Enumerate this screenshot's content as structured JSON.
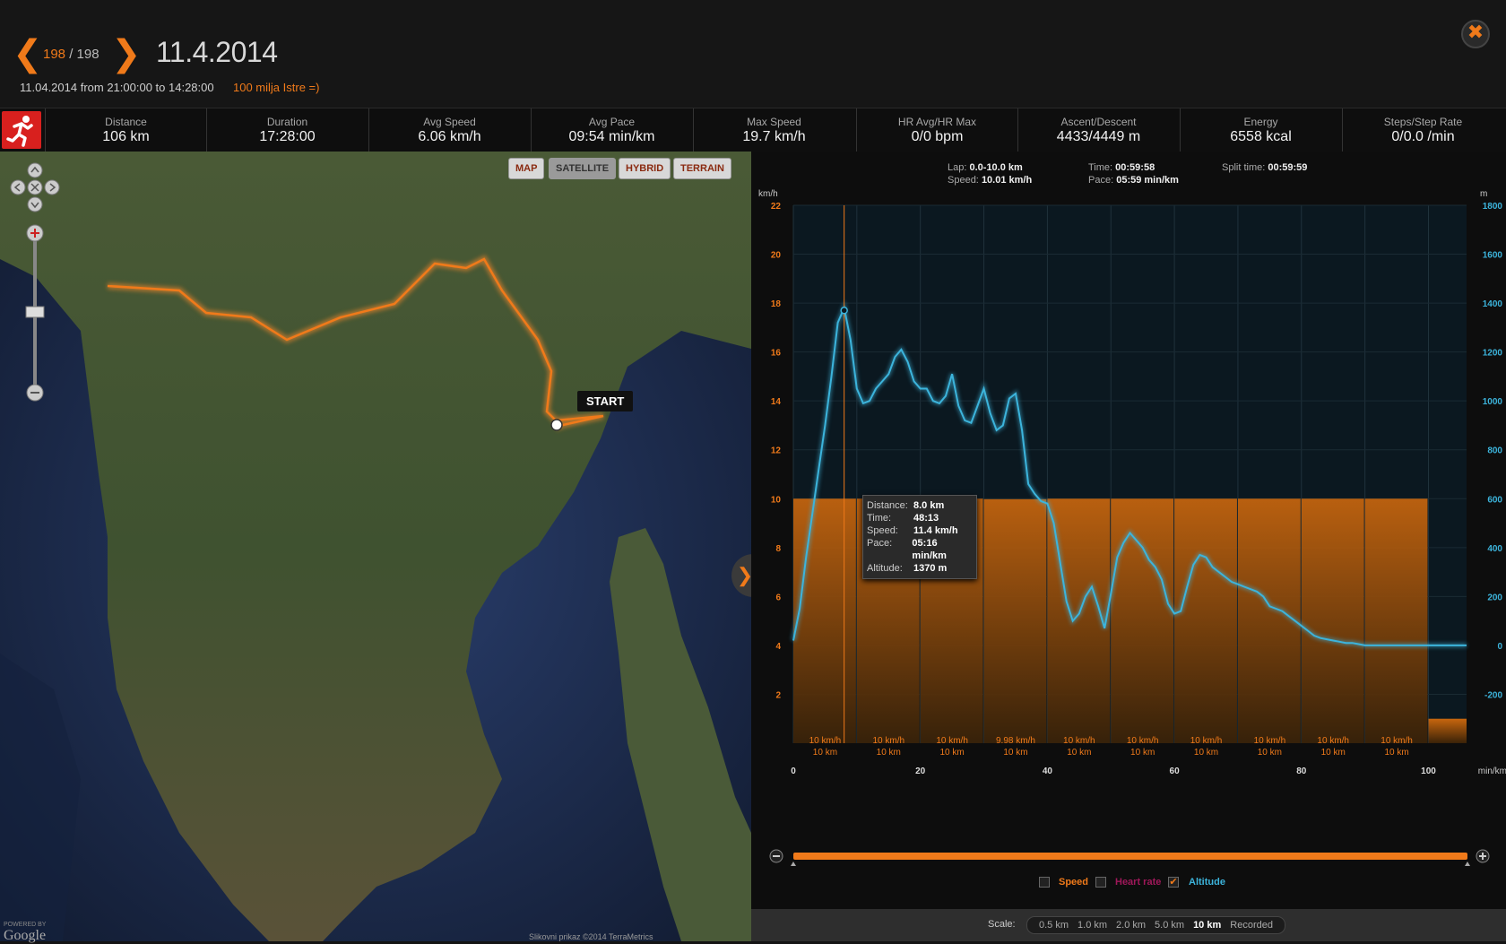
{
  "header": {
    "current_index": "198",
    "separator": "/",
    "total": "198",
    "date": "11.4.2014",
    "time_range": "11.04.2014  from 21:00:00 to 14:28:00",
    "route_name": "100 milja Istre =)"
  },
  "stats": [
    {
      "label": "Distance",
      "value": "106 km"
    },
    {
      "label": "Duration",
      "value": "17:28:00"
    },
    {
      "label": "Avg Speed",
      "value": "6.06 km/h"
    },
    {
      "label": "Avg Pace",
      "value": "09:54 min/km"
    },
    {
      "label": "Max Speed",
      "value": "19.7 km/h"
    },
    {
      "label": "HR Avg/HR Max",
      "value": "0/0 bpm"
    },
    {
      "label": "Ascent/Descent",
      "value": "4433/4449 m"
    },
    {
      "label": "Energy",
      "value": "6558 kcal"
    },
    {
      "label": "Steps/Step Rate",
      "value": "0/0.0 /min"
    }
  ],
  "map": {
    "types": [
      "MAP",
      "SATELLITE",
      "HYBRID",
      "TERRAIN"
    ],
    "active_type": "SATELLITE",
    "start_label": "START",
    "powered_by": "POWERED BY",
    "google": "Google",
    "copyright": "Slikovni prikaz ©2014 TerraMetrics"
  },
  "lap": {
    "lap_label": "Lap:",
    "lap_value": "0.0-10.0 km",
    "speed_label": "Speed:",
    "speed_value": "10.01 km/h",
    "time_label": "Time:",
    "time_value": "00:59:58",
    "pace_label": "Pace:",
    "pace_value": "05:59 min/km",
    "split_label": "Split time:",
    "split_value": "00:59:59"
  },
  "tooltip": {
    "distance_label": "Distance:",
    "distance": "8.0 km",
    "time_label": "Time:",
    "time": "48:13",
    "speed_label": "Speed:",
    "speed": "11.4 km/h",
    "pace_label": "Pace:",
    "pace": "05:16 min/km",
    "altitude_label": "Altitude:",
    "altitude": "1370 m"
  },
  "legend": {
    "speed": "Speed",
    "heart_rate": "Heart rate",
    "altitude": "Altitude",
    "speed_checked": false,
    "heart_rate_checked": false,
    "altitude_checked": true
  },
  "footer": {
    "scale_label": "Scale:",
    "options": [
      "0.5 km",
      "1.0 km",
      "2.0 km",
      "5.0 km",
      "10 km",
      "Recorded"
    ],
    "selected": "10 km"
  },
  "colors": {
    "accent": "#f07a1a",
    "altitude_line": "#3cb4dc",
    "lap_fill": "#c8660e"
  },
  "chart_data": {
    "type": "area",
    "left_axis_label": "km/h",
    "right_axis_label": "m",
    "x_axis_unit": "min/km",
    "left_ticks": [
      "2",
      "4",
      "6",
      "8",
      "10",
      "12",
      "14",
      "16",
      "18",
      "20",
      "22"
    ],
    "right_ticks": [
      "-200",
      "0",
      "200",
      "400",
      "600",
      "800",
      "1000",
      "1200",
      "1400",
      "1600",
      "1800"
    ],
    "x_ticks": [
      "0",
      "20",
      "40",
      "60",
      "80",
      "100"
    ],
    "ylim_left": [
      0,
      22
    ],
    "ylim_right": [
      -400,
      1800
    ],
    "xlim": [
      0,
      106
    ],
    "laps": [
      {
        "speed": "10 km/h",
        "dist": "10 km",
        "value": 10
      },
      {
        "speed": "10 km/h",
        "dist": "10 km",
        "value": 10
      },
      {
        "speed": "10 km/h",
        "dist": "10 km",
        "value": 10
      },
      {
        "speed": "9.98 km/h",
        "dist": "10 km",
        "value": 9.98
      },
      {
        "speed": "10 km/h",
        "dist": "10 km",
        "value": 10
      },
      {
        "speed": "10 km/h",
        "dist": "10 km",
        "value": 10
      },
      {
        "speed": "10 km/h",
        "dist": "10 km",
        "value": 10
      },
      {
        "speed": "10 km/h",
        "dist": "10 km",
        "value": 10
      },
      {
        "speed": "10 km/h",
        "dist": "10 km",
        "value": 10
      },
      {
        "speed": "10 km/h",
        "dist": "10 km",
        "value": 10
      }
    ],
    "last_lap_value": 1.0,
    "altitude": {
      "name": "Altitude",
      "x": [
        0,
        1,
        2,
        3,
        4,
        5,
        6,
        7,
        8,
        9,
        10,
        11,
        12,
        13,
        14,
        15,
        16,
        17,
        18,
        19,
        20,
        21,
        22,
        23,
        24,
        25,
        26,
        27,
        28,
        29,
        30,
        31,
        32,
        33,
        34,
        35,
        36,
        37,
        38,
        39,
        40,
        41,
        42,
        43,
        44,
        45,
        46,
        47,
        48,
        49,
        50,
        51,
        52,
        53,
        54,
        55,
        56,
        57,
        58,
        59,
        60,
        61,
        62,
        63,
        64,
        65,
        66,
        67,
        68,
        69,
        70,
        71,
        72,
        73,
        74,
        75,
        76,
        77,
        78,
        79,
        80,
        81,
        82,
        83,
        84,
        85,
        86,
        87,
        88,
        89,
        90,
        91,
        92,
        93,
        94,
        95,
        96,
        97,
        98,
        99,
        100,
        101,
        102,
        103,
        104,
        105,
        106
      ],
      "y": [
        20,
        150,
        360,
        540,
        720,
        900,
        1100,
        1320,
        1380,
        1250,
        1050,
        990,
        1000,
        1050,
        1080,
        1110,
        1180,
        1210,
        1160,
        1080,
        1050,
        1050,
        1000,
        990,
        1020,
        1110,
        980,
        920,
        910,
        980,
        1050,
        950,
        880,
        900,
        1010,
        1030,
        880,
        660,
        620,
        590,
        580,
        500,
        340,
        180,
        100,
        130,
        200,
        240,
        160,
        70,
        210,
        360,
        420,
        460,
        430,
        400,
        350,
        320,
        270,
        170,
        130,
        140,
        240,
        330,
        370,
        360,
        320,
        300,
        280,
        260,
        250,
        240,
        230,
        220,
        200,
        160,
        150,
        140,
        120,
        100,
        80,
        60,
        40,
        30,
        25,
        20,
        15,
        10,
        10,
        5,
        0,
        0,
        0,
        0,
        0,
        0,
        0,
        0,
        0,
        0,
        0,
        0,
        0,
        0,
        0,
        0,
        0
      ]
    },
    "cursor_x": 8.0
  }
}
